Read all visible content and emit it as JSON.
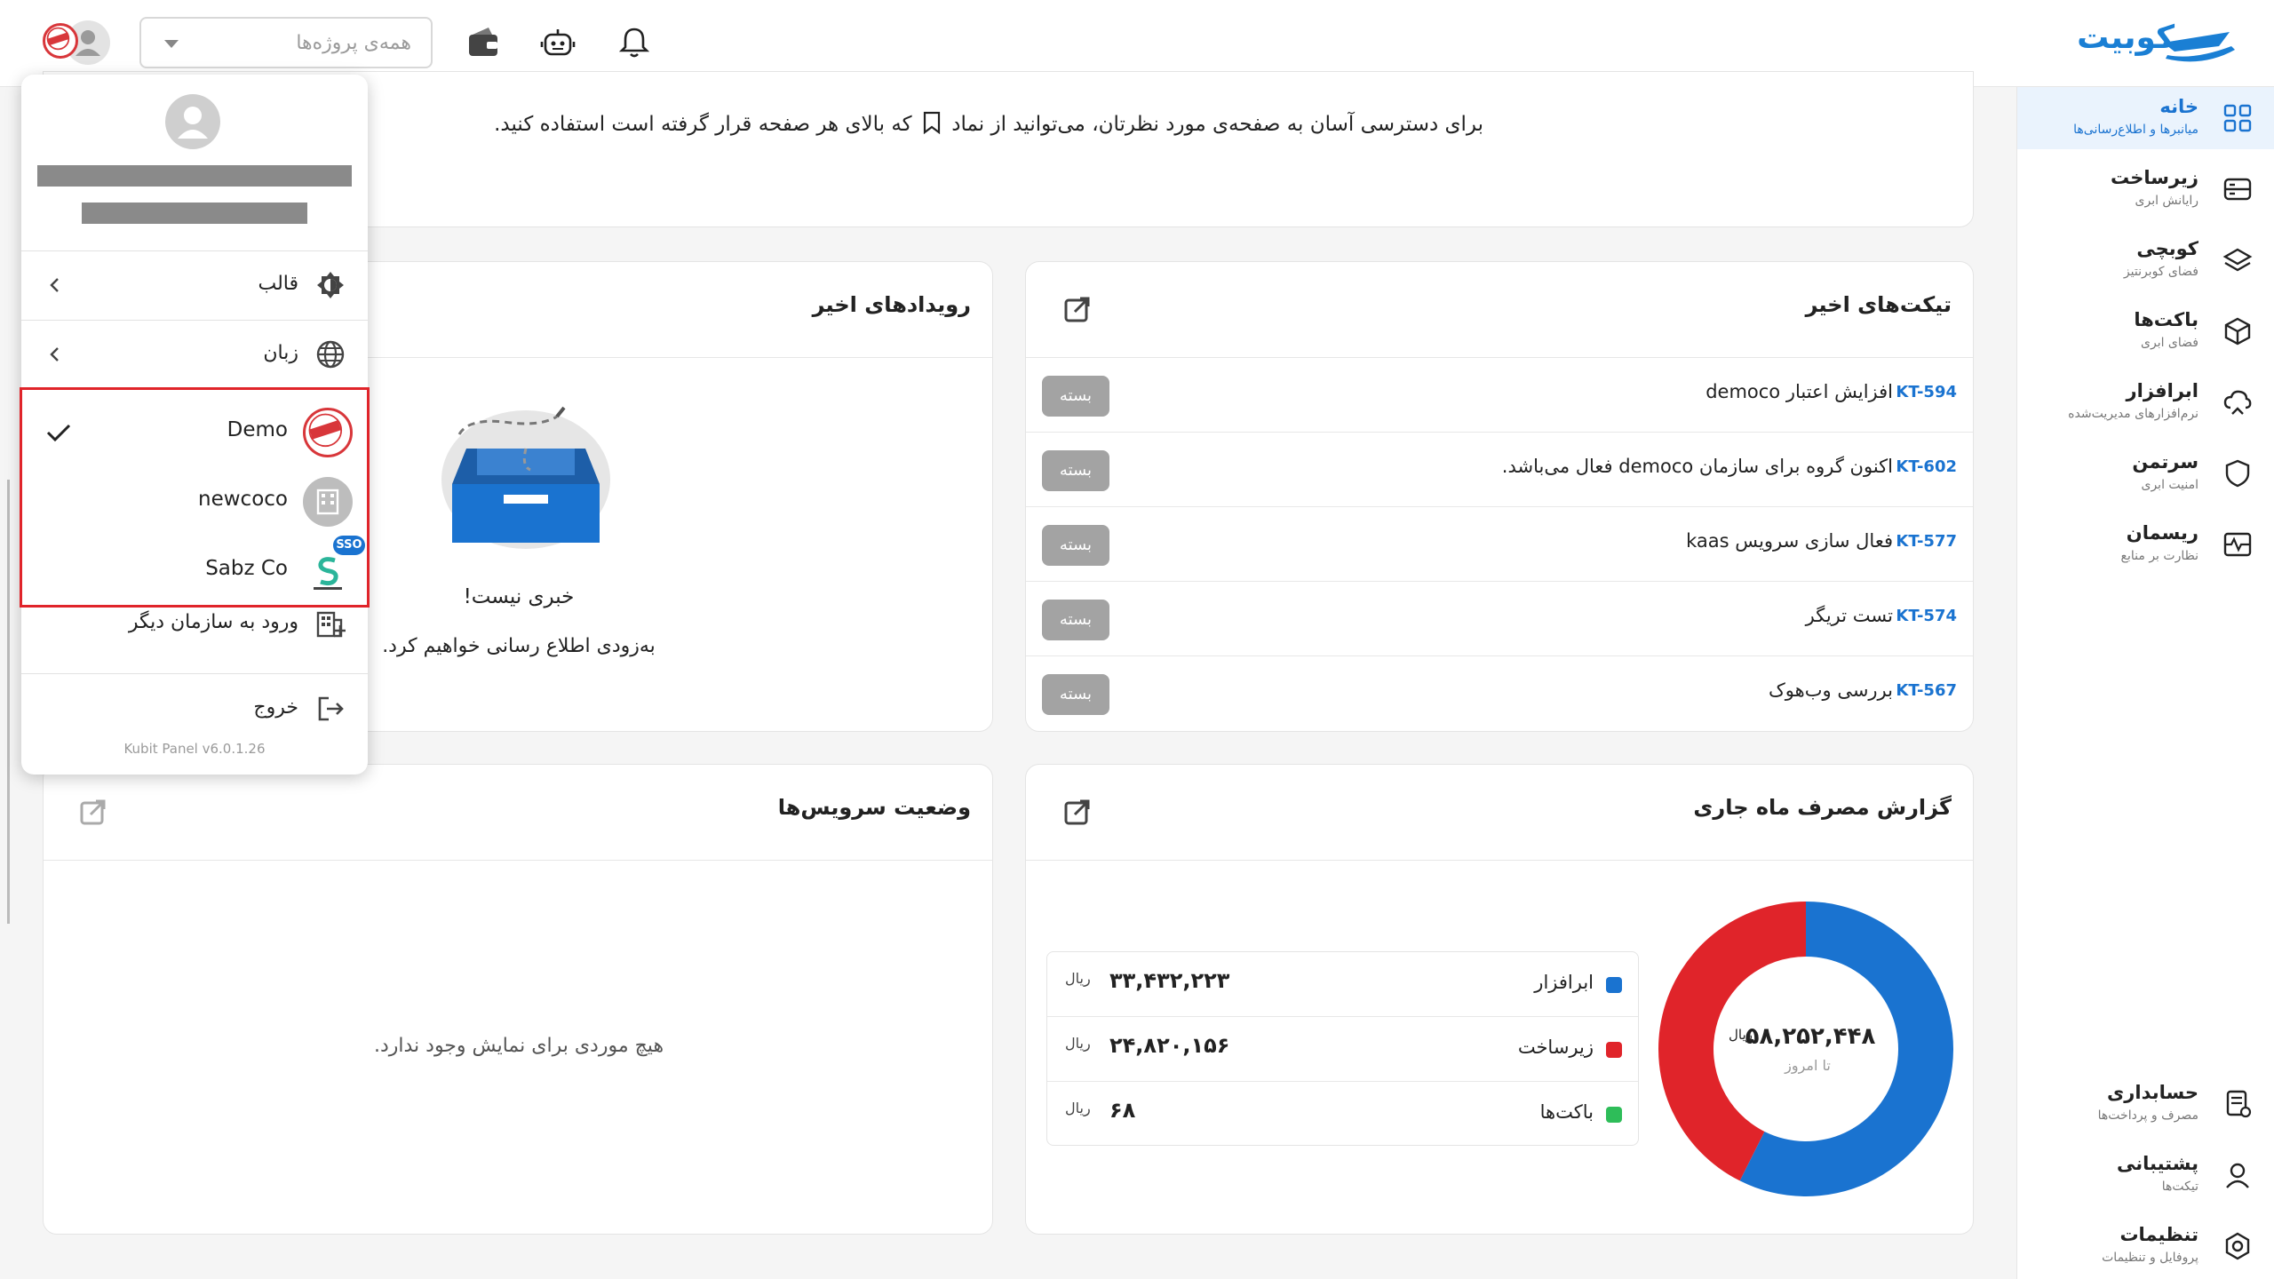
{
  "header": {
    "logo_text": "کوبیت",
    "project_placeholder": "همه‌ی پروژه‌ها"
  },
  "info": {
    "text_part1": "برای دسترسی آسان به صفحه‌ی مورد نظرتان، می‌توانید از نماد",
    "text_part2": "که بالای هر صفحه قرار گرفته است استفاده کنید."
  },
  "sidebar": {
    "items": [
      {
        "title": "خانه",
        "sub": "میانبرها و اطلاع‌رسانی‌ها",
        "icon": "dashboard-icon",
        "active": true
      },
      {
        "title": "زیرساخت",
        "sub": "رایانش ابری",
        "icon": "server-icon"
      },
      {
        "title": "کوبچی",
        "sub": "فضای کوبرنتیز",
        "icon": "layers-icon"
      },
      {
        "title": "باکت‌ها",
        "sub": "فضای ابری",
        "icon": "box-icon"
      },
      {
        "title": "ابرافزار",
        "sub": "نرم‌افزارهای مدیریت‌شده",
        "icon": "cloud-app-icon"
      },
      {
        "title": "سرتمن",
        "sub": "امنیت ابری",
        "icon": "shield-icon"
      },
      {
        "title": "ریسمان",
        "sub": "نظارت بر منابع",
        "icon": "monitor-icon"
      }
    ],
    "bottom_items": [
      {
        "title": "حسابداری",
        "sub": "مصرف و پرداخت‌ها",
        "icon": "accounting-icon"
      },
      {
        "title": "پشتیبانی",
        "sub": "تیکت‌ها",
        "icon": "support-icon"
      },
      {
        "title": "تنظیمات",
        "sub": "پروفایل و تنظیمات",
        "icon": "settings-icon"
      }
    ]
  },
  "tickets": {
    "title": "تیکت‌های اخیر",
    "rows": [
      {
        "id": "KT-594",
        "text": "افزایش اعتبار democo",
        "status": "بسته"
      },
      {
        "id": "KT-602",
        "text": "اکنون گروه برای سازمان democo فعال می‌باشد.",
        "status": "بسته"
      },
      {
        "id": "KT-577",
        "text": "فعال سازی سرویس kaas",
        "status": "بسته"
      },
      {
        "id": "KT-574",
        "text": "تست تریگر",
        "status": "بسته"
      },
      {
        "id": "KT-567",
        "text": "بررسی وب‌هوک",
        "status": "بسته"
      }
    ]
  },
  "events": {
    "title": "رویدادهای اخیر",
    "empty_title": "خبری نیست!",
    "empty_sub": "به‌زودی اطلاع رسانی خواهیم کرد."
  },
  "usage": {
    "title": "گزارش مصرف ماه جاری",
    "total": "۵۸,۲۵۲,۴۴۸",
    "total_unit": "ریال",
    "total_sub": "تا امروز",
    "unit": "ریال",
    "items": [
      {
        "name": "ابرافزار",
        "value": "۳۳,۴۳۲,۲۲۳",
        "color": "#1a73d0"
      },
      {
        "name": "زیرساخت",
        "value": "۲۴,۸۲۰,۱۵۶",
        "color": "#e0242a"
      },
      {
        "name": "باکت‌ها",
        "value": "۶۸",
        "color": "#2ebd59"
      }
    ]
  },
  "chart_data": {
    "type": "pie",
    "categories": [
      "ابرافزار",
      "زیرساخت",
      "باکت‌ها"
    ],
    "values": [
      33432223,
      24820156,
      68
    ],
    "colors": [
      "#1a73d0",
      "#e0242a",
      "#2ebd59"
    ],
    "donut": true
  },
  "services": {
    "title": "وضعیت سرویس‌ها",
    "empty": "هیچ موردی برای نمایش وجود ندارد."
  },
  "menu": {
    "theme_label": "قالب",
    "language_label": "زبان",
    "orgs": [
      {
        "name": "Demo",
        "selected": true
      },
      {
        "name": "newcoco",
        "selected": false
      },
      {
        "name": "Sabz Co",
        "selected": false,
        "badge": "SSO"
      }
    ],
    "other_org_label": "ورود به سازمان دیگر",
    "logout_label": "خروج",
    "version": "Kubit Panel v6.0.1.26"
  }
}
